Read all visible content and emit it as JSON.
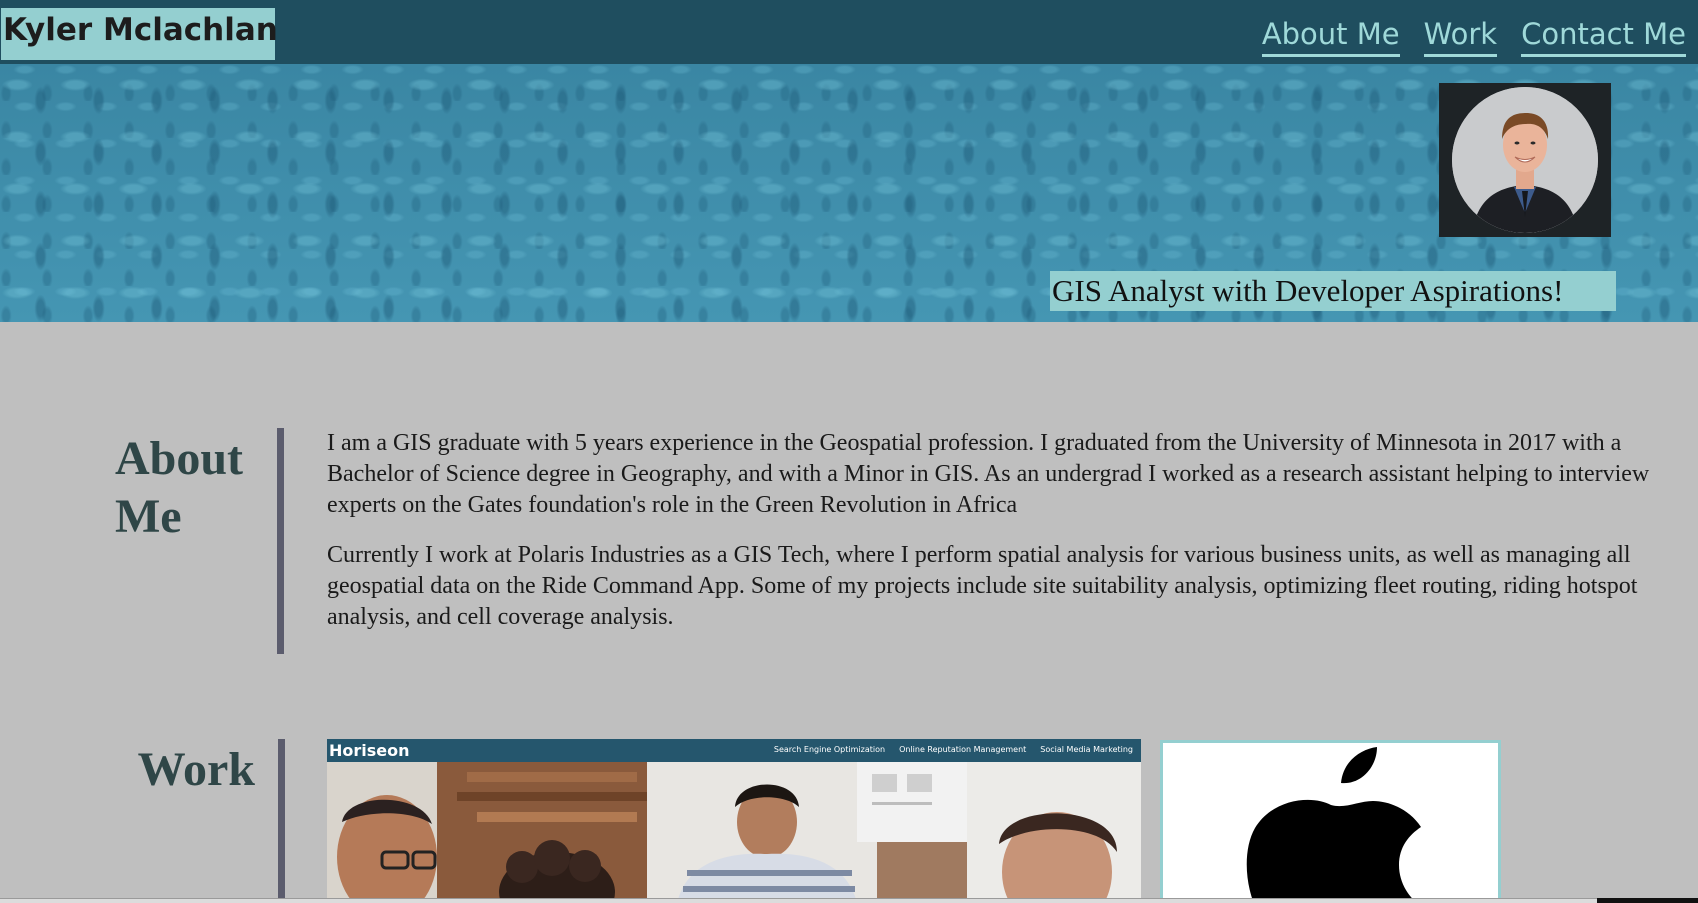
{
  "nav": {
    "brand": "Kyler Mclachlan",
    "links": [
      {
        "label": "About Me"
      },
      {
        "label": "Work"
      },
      {
        "label": "Contact Me"
      }
    ]
  },
  "hero": {
    "tagline": "GIS Analyst with Developer Aspirations!",
    "avatar_icon": "profile-photo"
  },
  "about": {
    "title": "About Me",
    "paragraphs": [
      "I am a GIS graduate with 5 years experience in the Geospatial profession. I graduated from the University of Minnesota in 2017 with a Bachelor of Science degree in Geography, and with a Minor in GIS. As an undergrad I worked as a research assistant helping to interview experts on the Gates foundation's role in the Green Revolution in Africa",
      "Currently I work at Polaris Industries as a GIS Tech, where I perform spatial analysis for various business units, as well as managing all geospatial data on the Ride Command App. Some of my projects include site suitability analysis, optimizing fleet routing, riding hotspot analysis, and cell coverage analysis."
    ]
  },
  "work": {
    "title": "Work",
    "projects": [
      {
        "brand": "Horiseon",
        "nav": [
          "Search Engine Optimization",
          "Online Reputation Management",
          "Social Media Marketing"
        ]
      },
      {
        "icon": "apple-logo-icon"
      }
    ]
  },
  "colors": {
    "nav_bg": "#1f4e5f",
    "accent": "#94cfd0",
    "link": "#9fd9d9",
    "body_bg": "#bfbfbf",
    "heading": "#2f4647",
    "divider": "#5b5c6d"
  }
}
